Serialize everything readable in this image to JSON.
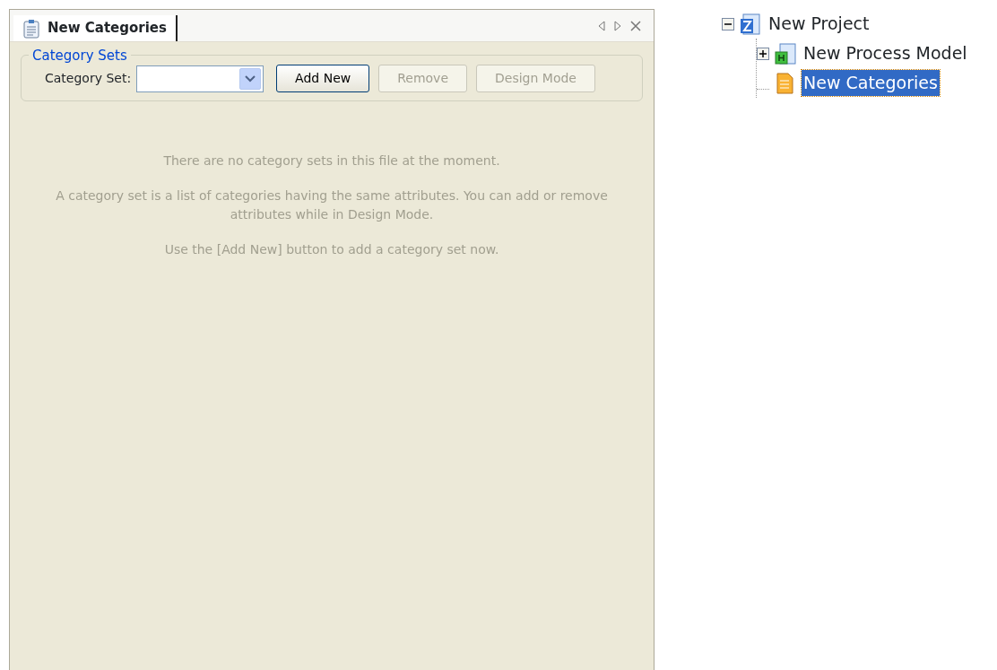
{
  "panel": {
    "tab": {
      "label": "New Categories",
      "selected": true
    },
    "group": {
      "title": "Category Sets",
      "label": "Category Set:",
      "buttons": [
        {
          "label": "Add New",
          "disabled": false
        },
        {
          "label": "Remove",
          "disabled": true
        },
        {
          "label": "Design Mode",
          "disabled": true
        }
      ]
    },
    "messages": [
      "There are no category sets in this file at the moment.",
      "A category set is a list of categories having the same attributes. You can add or remove attributes while in  Design Mode.",
      "Use the [Add New] button to add a category set now."
    ]
  },
  "tree": [
    {
      "label": "New Project",
      "kind": "project",
      "expanded": true,
      "selected": false,
      "children": [
        {
          "label": "New Process Model",
          "kind": "model",
          "expanded": false,
          "selected": false
        },
        {
          "label": "New Categories",
          "kind": "categories",
          "selected": true
        }
      ]
    }
  ]
}
